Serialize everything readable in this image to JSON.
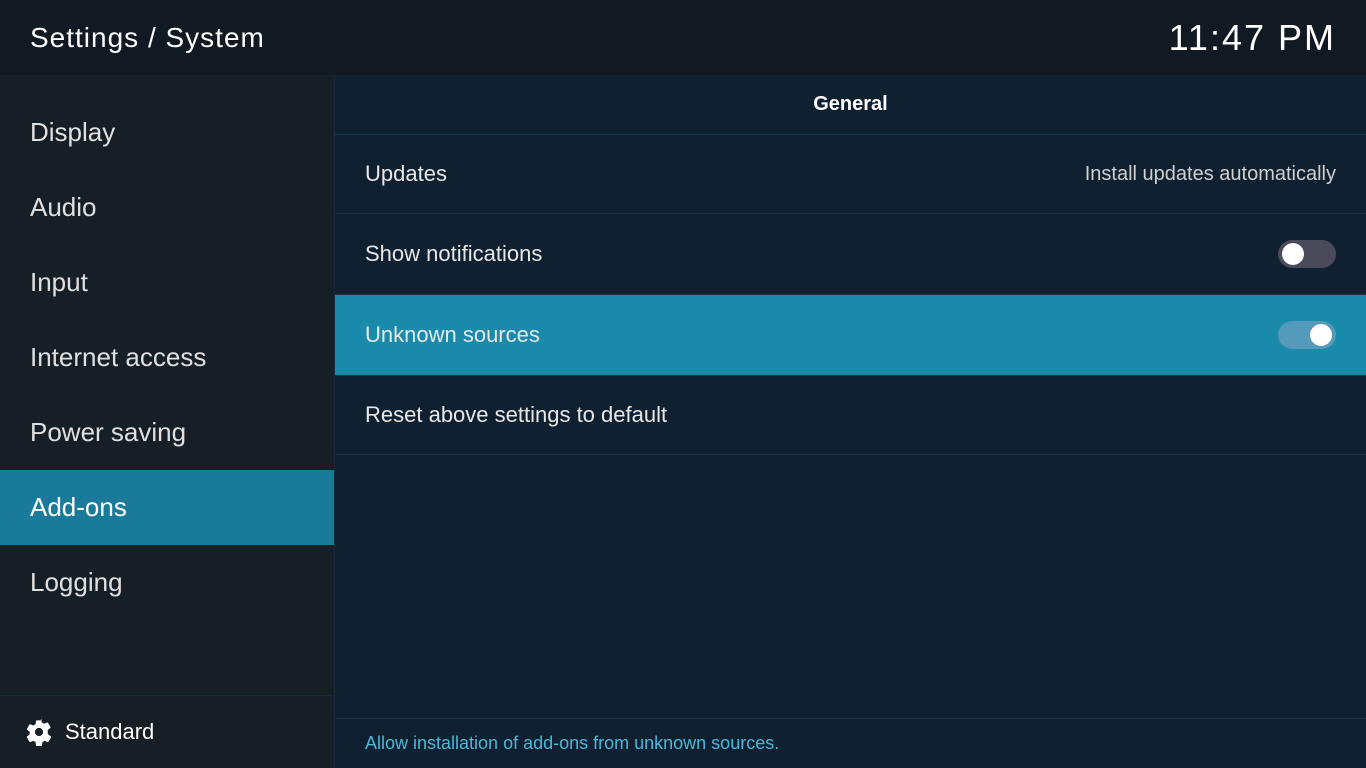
{
  "header": {
    "title": "Settings / System",
    "time": "11:47 PM"
  },
  "sidebar": {
    "items": [
      {
        "id": "display",
        "label": "Display",
        "active": false
      },
      {
        "id": "audio",
        "label": "Audio",
        "active": false
      },
      {
        "id": "input",
        "label": "Input",
        "active": false
      },
      {
        "id": "internet-access",
        "label": "Internet access",
        "active": false
      },
      {
        "id": "power-saving",
        "label": "Power saving",
        "active": false
      },
      {
        "id": "add-ons",
        "label": "Add-ons",
        "active": true
      },
      {
        "id": "logging",
        "label": "Logging",
        "active": false
      }
    ],
    "footer": {
      "label": "Standard",
      "icon": "gear"
    }
  },
  "content": {
    "section_label": "General",
    "settings": [
      {
        "id": "updates",
        "label": "Updates",
        "value": "Install updates automatically",
        "control": "text",
        "highlighted": false
      },
      {
        "id": "show-notifications",
        "label": "Show notifications",
        "value": "",
        "control": "toggle",
        "toggle_state": "off",
        "highlighted": false
      },
      {
        "id": "unknown-sources",
        "label": "Unknown sources",
        "value": "",
        "control": "toggle",
        "toggle_state": "on",
        "highlighted": true
      },
      {
        "id": "reset-settings",
        "label": "Reset above settings to default",
        "value": "",
        "control": "none",
        "highlighted": false
      }
    ],
    "status_text": "Allow installation of add-ons from unknown sources."
  }
}
